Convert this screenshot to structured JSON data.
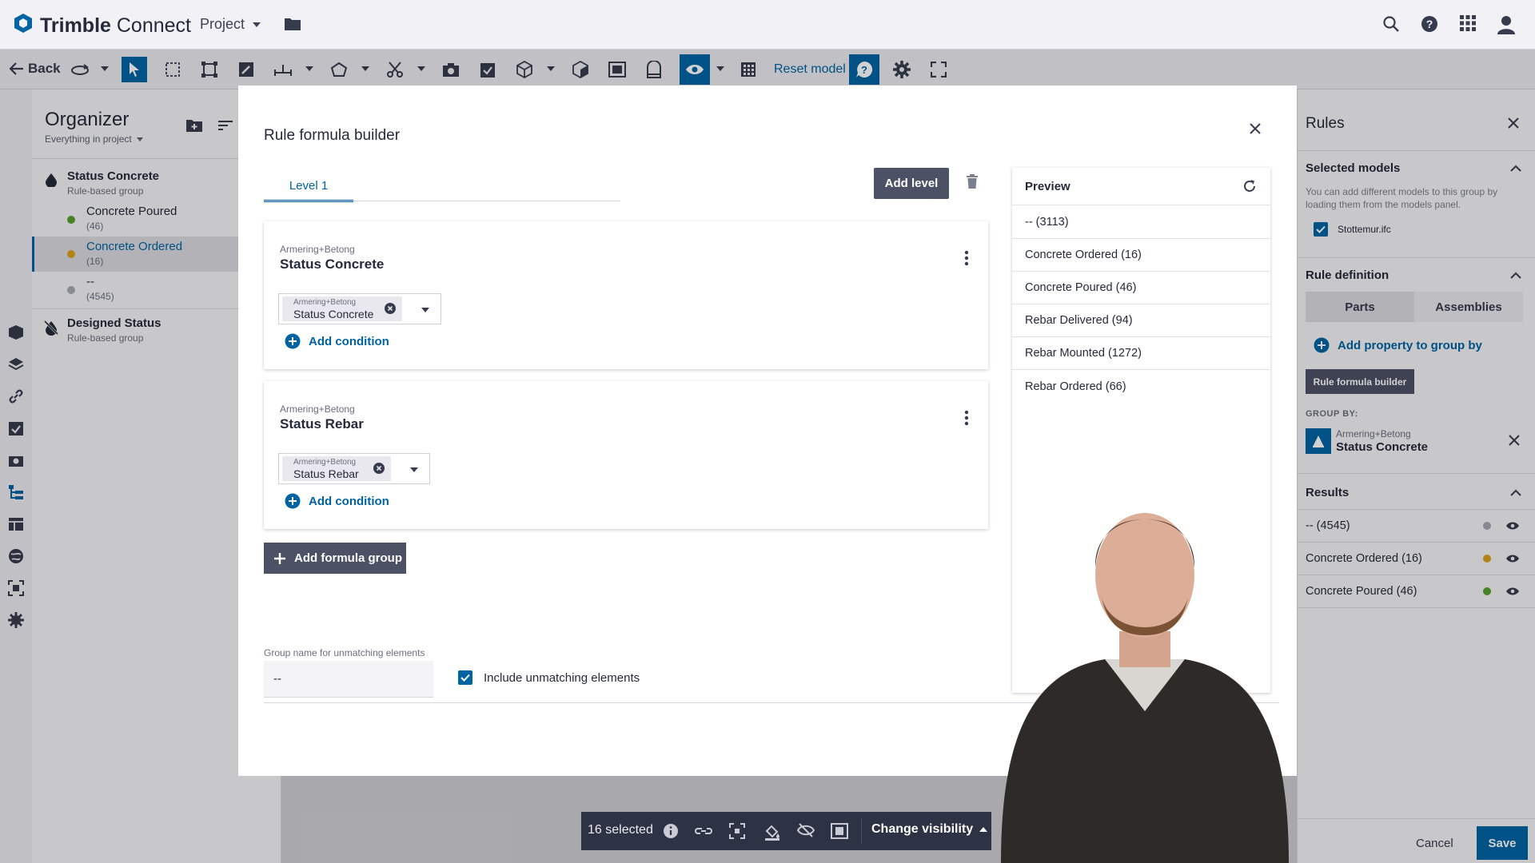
{
  "brand": {
    "name_part1": "Trimble",
    "name_part2": "Connect"
  },
  "project_menu": {
    "label": "Project"
  },
  "toolbar": {
    "back_label": "Back",
    "reset_model_label": "Reset model"
  },
  "organizer": {
    "title": "Organizer",
    "subtitle": "Everything in project",
    "groups": [
      {
        "name": "Status Concrete",
        "type": "Rule-based group",
        "children": [
          {
            "name": "Concrete Poured",
            "count": "(46)",
            "color": "#5a9e2e"
          },
          {
            "name": "Concrete Ordered",
            "count": "(16)",
            "color": "#d9a21b"
          },
          {
            "name": "--",
            "count": "(4545)",
            "color": "#a8a8b2"
          }
        ]
      },
      {
        "name": "Designed Status",
        "type": "Rule-based group"
      }
    ]
  },
  "modal": {
    "title": "Rule formula builder",
    "tab_label": "Level 1",
    "add_level_label": "Add level",
    "conditions": [
      {
        "property_set": "Armering+Betong",
        "property": "Status Concrete",
        "chip_set": "Armering+Betong",
        "chip_value": "Status Concrete",
        "add_label": "Add condition"
      },
      {
        "property_set": "Armering+Betong",
        "property": "Status Rebar",
        "chip_set": "Armering+Betong",
        "chip_value": "Status Rebar",
        "add_label": "Add condition"
      }
    ],
    "add_formula_group_label": "Add formula group",
    "unmatching_label": "Group name for unmatching elements",
    "unmatching_value": "--",
    "include_unmatching_label": "Include unmatching elements",
    "include_unmatching_checked": true
  },
  "preview": {
    "title": "Preview",
    "rows": [
      "-- (3113)",
      "Concrete Ordered (16)",
      "Concrete Poured (46)",
      "Rebar Delivered (94)",
      "Rebar Mounted (1272)",
      "Rebar Ordered (66)"
    ]
  },
  "rules": {
    "title": "Rules",
    "selected_models_label": "Selected models",
    "selected_models_help": "You can add different models to this group by loading them from the models panel.",
    "model_file": "Stottemur.ifc",
    "rule_definition_label": "Rule definition",
    "tab_parts": "Parts",
    "tab_assemblies": "Assemblies",
    "add_property_label": "Add property to group by",
    "rule_formula_builder_btn": "Rule formula builder",
    "group_by_label": "GROUP BY:",
    "group_by_set": "Armering+Betong",
    "group_by_value": "Status Concrete",
    "results_label": "Results",
    "results": [
      {
        "label": "-- (4545)",
        "color": "#a8a8b2"
      },
      {
        "label": "Concrete Ordered (16)",
        "color": "#d9a21b"
      },
      {
        "label": "Concrete Poured (46)",
        "color": "#5a9e2e"
      }
    ],
    "cancel_label": "Cancel",
    "save_label": "Save"
  },
  "selection_bar": {
    "count_label": "16 selected",
    "change_visibility_label": "Change visibility"
  },
  "colors": {
    "accent": "#0063a3",
    "dark_button": "#4c5166",
    "bar": "#2d3244"
  }
}
